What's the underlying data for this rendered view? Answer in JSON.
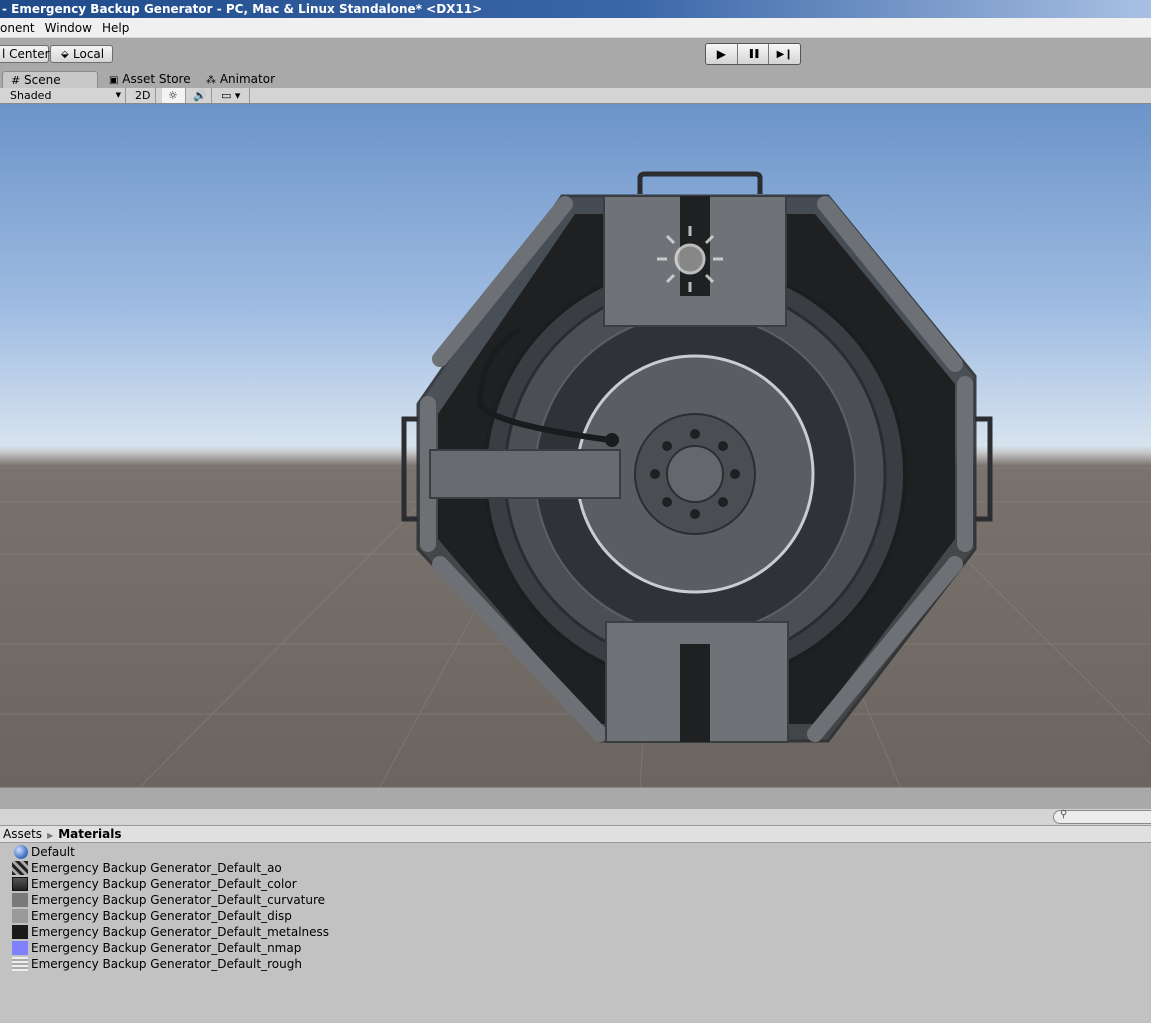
{
  "window": {
    "title": "- Emergency Backup Generator - PC, Mac & Linux Standalone* <DX11>"
  },
  "menu": [
    "onent",
    "Window",
    "Help"
  ],
  "toolbar": {
    "pivot_label": "l Center",
    "space_label": "Local"
  },
  "playbar": {
    "play": "▶",
    "pause": "❚❚",
    "step": "▶❙"
  },
  "tabs": [
    {
      "label": "Scene",
      "icon": "grid-icon"
    },
    {
      "label": "Asset Store",
      "icon": "store-icon"
    },
    {
      "label": "Animator",
      "icon": "animator-icon"
    }
  ],
  "scene": {
    "shading_mode": "Shaded",
    "mode_2d": "2D"
  },
  "project": {
    "breadcrumb": [
      "Assets",
      "Materials"
    ],
    "files": [
      {
        "name": "Default",
        "thumb": "sphere",
        "color": "#4a78c8"
      },
      {
        "name": "Emergency Backup Generator_Default_ao",
        "thumb": "texture",
        "color": "#888888"
      },
      {
        "name": "Emergency Backup Generator_Default_color",
        "thumb": "texture",
        "color": "#444444"
      },
      {
        "name": "Emergency Backup Generator_Default_curvature",
        "thumb": "texture",
        "color": "#7a7a7a"
      },
      {
        "name": "Emergency Backup Generator_Default_disp",
        "thumb": "texture",
        "color": "#9a9a9a"
      },
      {
        "name": "Emergency Backup Generator_Default_metalness",
        "thumb": "texture",
        "color": "#1a1a1a"
      },
      {
        "name": "Emergency Backup Generator_Default_nmap",
        "thumb": "texture",
        "color": "#7f7fff"
      },
      {
        "name": "Emergency Backup Generator_Default_rough",
        "thumb": "texture",
        "color": "#d0d0d0"
      }
    ]
  }
}
